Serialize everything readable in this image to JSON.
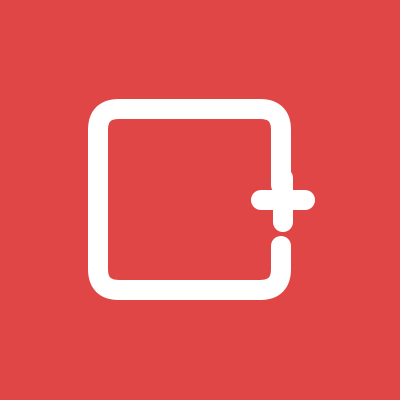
{
  "app_icon": {
    "icon": "square-plus-icon",
    "background_color": "#e04646",
    "glyph_color": "#ffffff"
  }
}
